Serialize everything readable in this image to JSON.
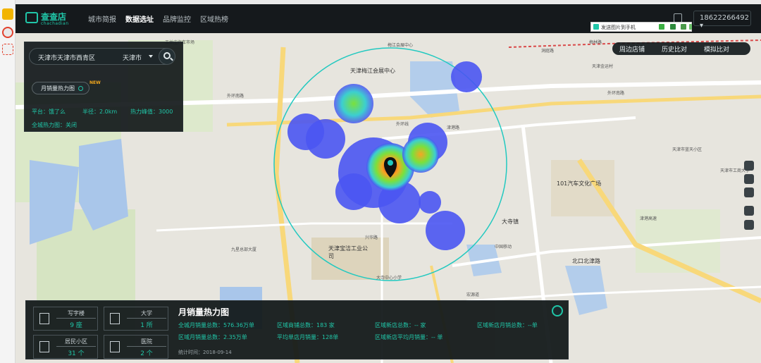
{
  "header": {
    "logo_name": "查查店",
    "logo_sub": "chachadian",
    "nav": [
      "城市简报",
      "数据选址",
      "品牌监控",
      "区域热榜"
    ],
    "active_nav": "数据选址",
    "phone": "18622266492 ▾",
    "bag_icon": "shopping-bag-icon"
  },
  "send_bar": {
    "label": "发送图片到手机"
  },
  "tabs": [
    "周边店铺",
    "历史比对",
    "模拟比对"
  ],
  "search_panel": {
    "query": "天津市天津市西青区",
    "city": "天津市",
    "heat_tag": "月销量热力图",
    "new_badge": "NEW",
    "platform": "平台：饿了么",
    "radius": "半径：2.0km",
    "peak": "热力峰值：3000",
    "citywide": "全城热力图：关闭"
  },
  "map_labels": [
    "王兰庄汽车市场",
    "梅江会展中心",
    "天津梅江会展中心",
    "外环线",
    "津港路",
    "天津金运村",
    "天津宝洁工业公司",
    "101汽车文化广场",
    "兴华路",
    "大寺镇",
    "北口北津路",
    "宏源道",
    "九星总部大厦",
    "中国移动",
    "梅林路",
    "洞庭路",
    "外环南路",
    "外环南路",
    "津港高速",
    "大寺中心小学",
    "天津市工商大学",
    "天津市蓝天小区"
  ],
  "bottom_panel": {
    "cards": [
      {
        "title": "写字楼",
        "value": "9 座",
        "icon": "office-building-icon"
      },
      {
        "title": "大学",
        "value": "1 所",
        "icon": "university-icon"
      },
      {
        "title": "居民小区",
        "value": "31 个",
        "icon": "residential-icon"
      },
      {
        "title": "医院",
        "value": "2 个",
        "icon": "hospital-icon"
      }
    ],
    "title": "月销量热力图",
    "stats": {
      "city_total": "全城月销量总数：576.36万单",
      "region_total": "区域月销量总数：2.35万单",
      "region_shops": "区域商铺总数：183 家",
      "avg_sales": "平均单店月销量：128单",
      "new_shops": "区域新店总数：-- 家",
      "new_avg": "区域新店平均月销量：-- 单",
      "new_monthly": "区域新店月销总数：--单"
    },
    "time": "统计时间：2018-09-14"
  },
  "colors": {
    "accent": "#20c6a8",
    "heat_low": "#4a55f2",
    "heat_high": "#e8221c"
  }
}
